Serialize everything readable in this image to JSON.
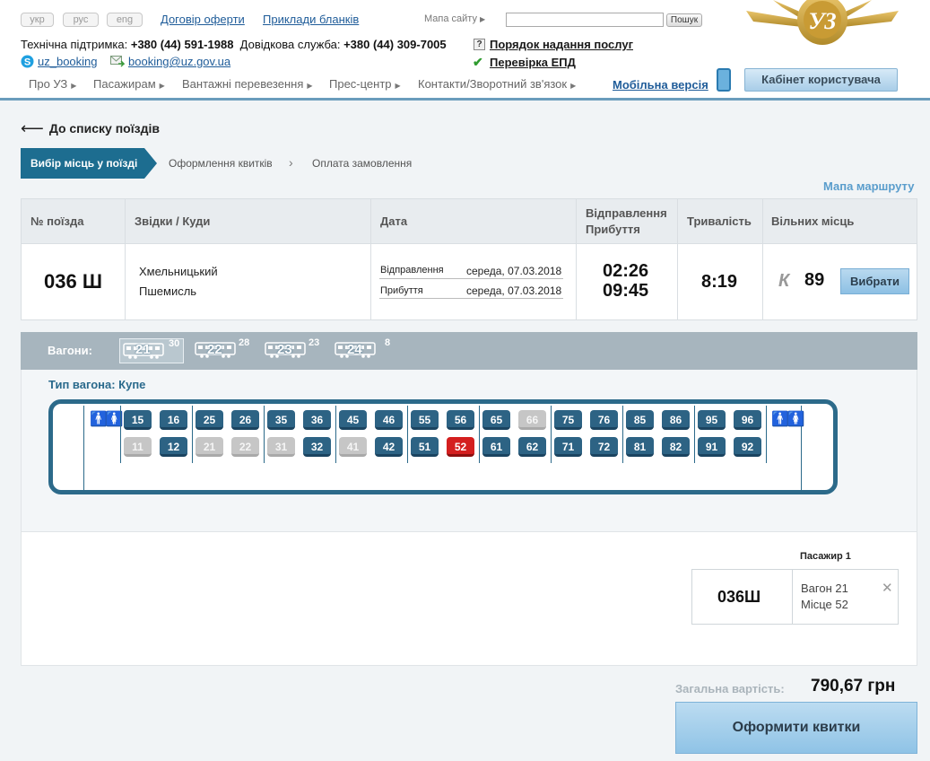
{
  "header": {
    "langs": [
      "укр",
      "рус",
      "eng"
    ],
    "links": [
      "Договір оферти",
      "Приклади бланків"
    ],
    "sitemap": "Мапа сайту",
    "search_btn": "Пошук",
    "support_label": "Технічна підтримка:",
    "support_phone": "+380 (44) 591-1988",
    "help_label": "Довідкова служба:",
    "help_phone": "+380 (44) 309-7005",
    "skype": "uz_booking",
    "email": "booking@uz.gov.ua",
    "service_order": "Порядок надання послуг",
    "check_epd": "Перевірка ЕПД",
    "nav": [
      "Про УЗ",
      "Пасажирам",
      "Вантажні перевезення",
      "Прес-центр",
      "Контакти/Зворотний зв'язок"
    ],
    "mobile": "Мобільна версія",
    "cabinet": "Кабінет користувача"
  },
  "back_link": "До списку поїздів",
  "steps": [
    "Вибір місць у поїзді",
    "Оформлення квитків",
    "Оплата замовлення"
  ],
  "route_map": "Мапа маршруту",
  "table": {
    "headers": [
      "№ поїзда",
      "Звідки / Куди",
      "Дата",
      "Відправлення",
      "Прибуття",
      "Тривалість",
      "Вільних місць"
    ],
    "train": "036 Ш",
    "from": "Хмельницький",
    "to": "Пшемисль",
    "dep_label": "Відправлення",
    "dep_date": "середа, 07.03.2018",
    "arr_label": "Прибуття",
    "arr_date": "середа, 07.03.2018",
    "dep_time": "02:26",
    "arr_time": "09:45",
    "duration": "8:19",
    "class": "К",
    "free": "89",
    "choose": "Вибрати"
  },
  "wagons": {
    "label": "Вагони:",
    "list": [
      {
        "num": "21",
        "free": "30"
      },
      {
        "num": "22",
        "free": "28"
      },
      {
        "num": "23",
        "free": "23"
      },
      {
        "num": "24",
        "free": "8"
      }
    ],
    "type": "Тип вагона: Купе"
  },
  "seats": {
    "top": [
      "15",
      "16",
      "25",
      "26",
      "35",
      "36",
      "45",
      "46",
      "55",
      "56",
      "65",
      "66",
      "75",
      "76",
      "85",
      "86",
      "95",
      "96"
    ],
    "bottom": [
      "11",
      "12",
      "21",
      "22",
      "31",
      "32",
      "41",
      "42",
      "51",
      "52",
      "61",
      "62",
      "71",
      "72",
      "81",
      "82",
      "91",
      "92"
    ],
    "taken": [
      "66",
      "11",
      "21",
      "22",
      "31",
      "41"
    ],
    "selected": "52"
  },
  "passenger": {
    "label": "Пасажир 1",
    "train": "036Ш",
    "wagon": "Вагон 21",
    "seat": "Місце 52"
  },
  "total_label": "Загальна вартість:",
  "total_value": "790,67 грн",
  "submit": "Оформити квитки"
}
